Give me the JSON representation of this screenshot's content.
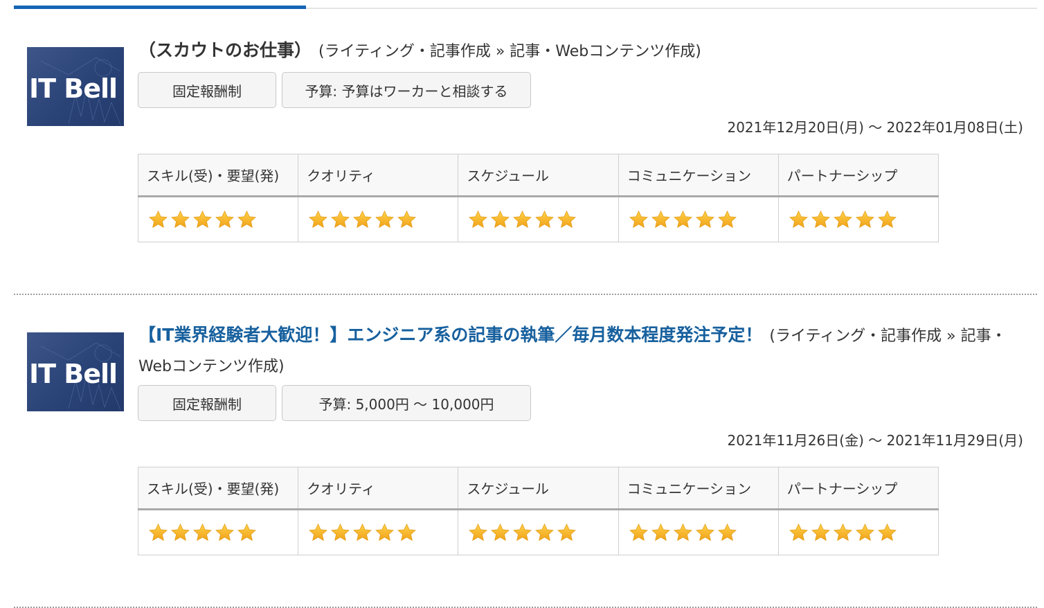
{
  "colors": {
    "tab_active": "#1565b6",
    "link": "#17609e",
    "star": "#f5b529"
  },
  "rating_headers": [
    "スキル(受)・要望(発)",
    "クオリティ",
    "スケジュール",
    "コミュニケーション",
    "パートナーシップ"
  ],
  "entries": [
    {
      "logo_text": "IT Bell",
      "title": "（スカウトのお仕事）",
      "title_is_link": false,
      "category": "(ライティング・記事作成 » 記事・Webコンテンツ作成)",
      "badge_type": "固定報酬制",
      "badge_budget": "予算: 予算はワーカーと相談する",
      "period": "2021年12月20日(月) 〜 2022年01月08日(土)",
      "ratings": [
        5,
        5,
        5,
        5,
        5
      ]
    },
    {
      "logo_text": "IT Bell",
      "title": "【IT業界経験者大歓迎！】エンジニア系の記事の執筆／毎月数本程度発注予定！",
      "title_is_link": true,
      "category": "(ライティング・記事作成 » 記事・Webコンテンツ作成)",
      "badge_type": "固定報酬制",
      "badge_budget": "予算: 5,000円 〜 10,000円",
      "period": "2021年11月26日(金) 〜 2021年11月29日(月)",
      "ratings": [
        5,
        5,
        5,
        5,
        5
      ]
    }
  ]
}
